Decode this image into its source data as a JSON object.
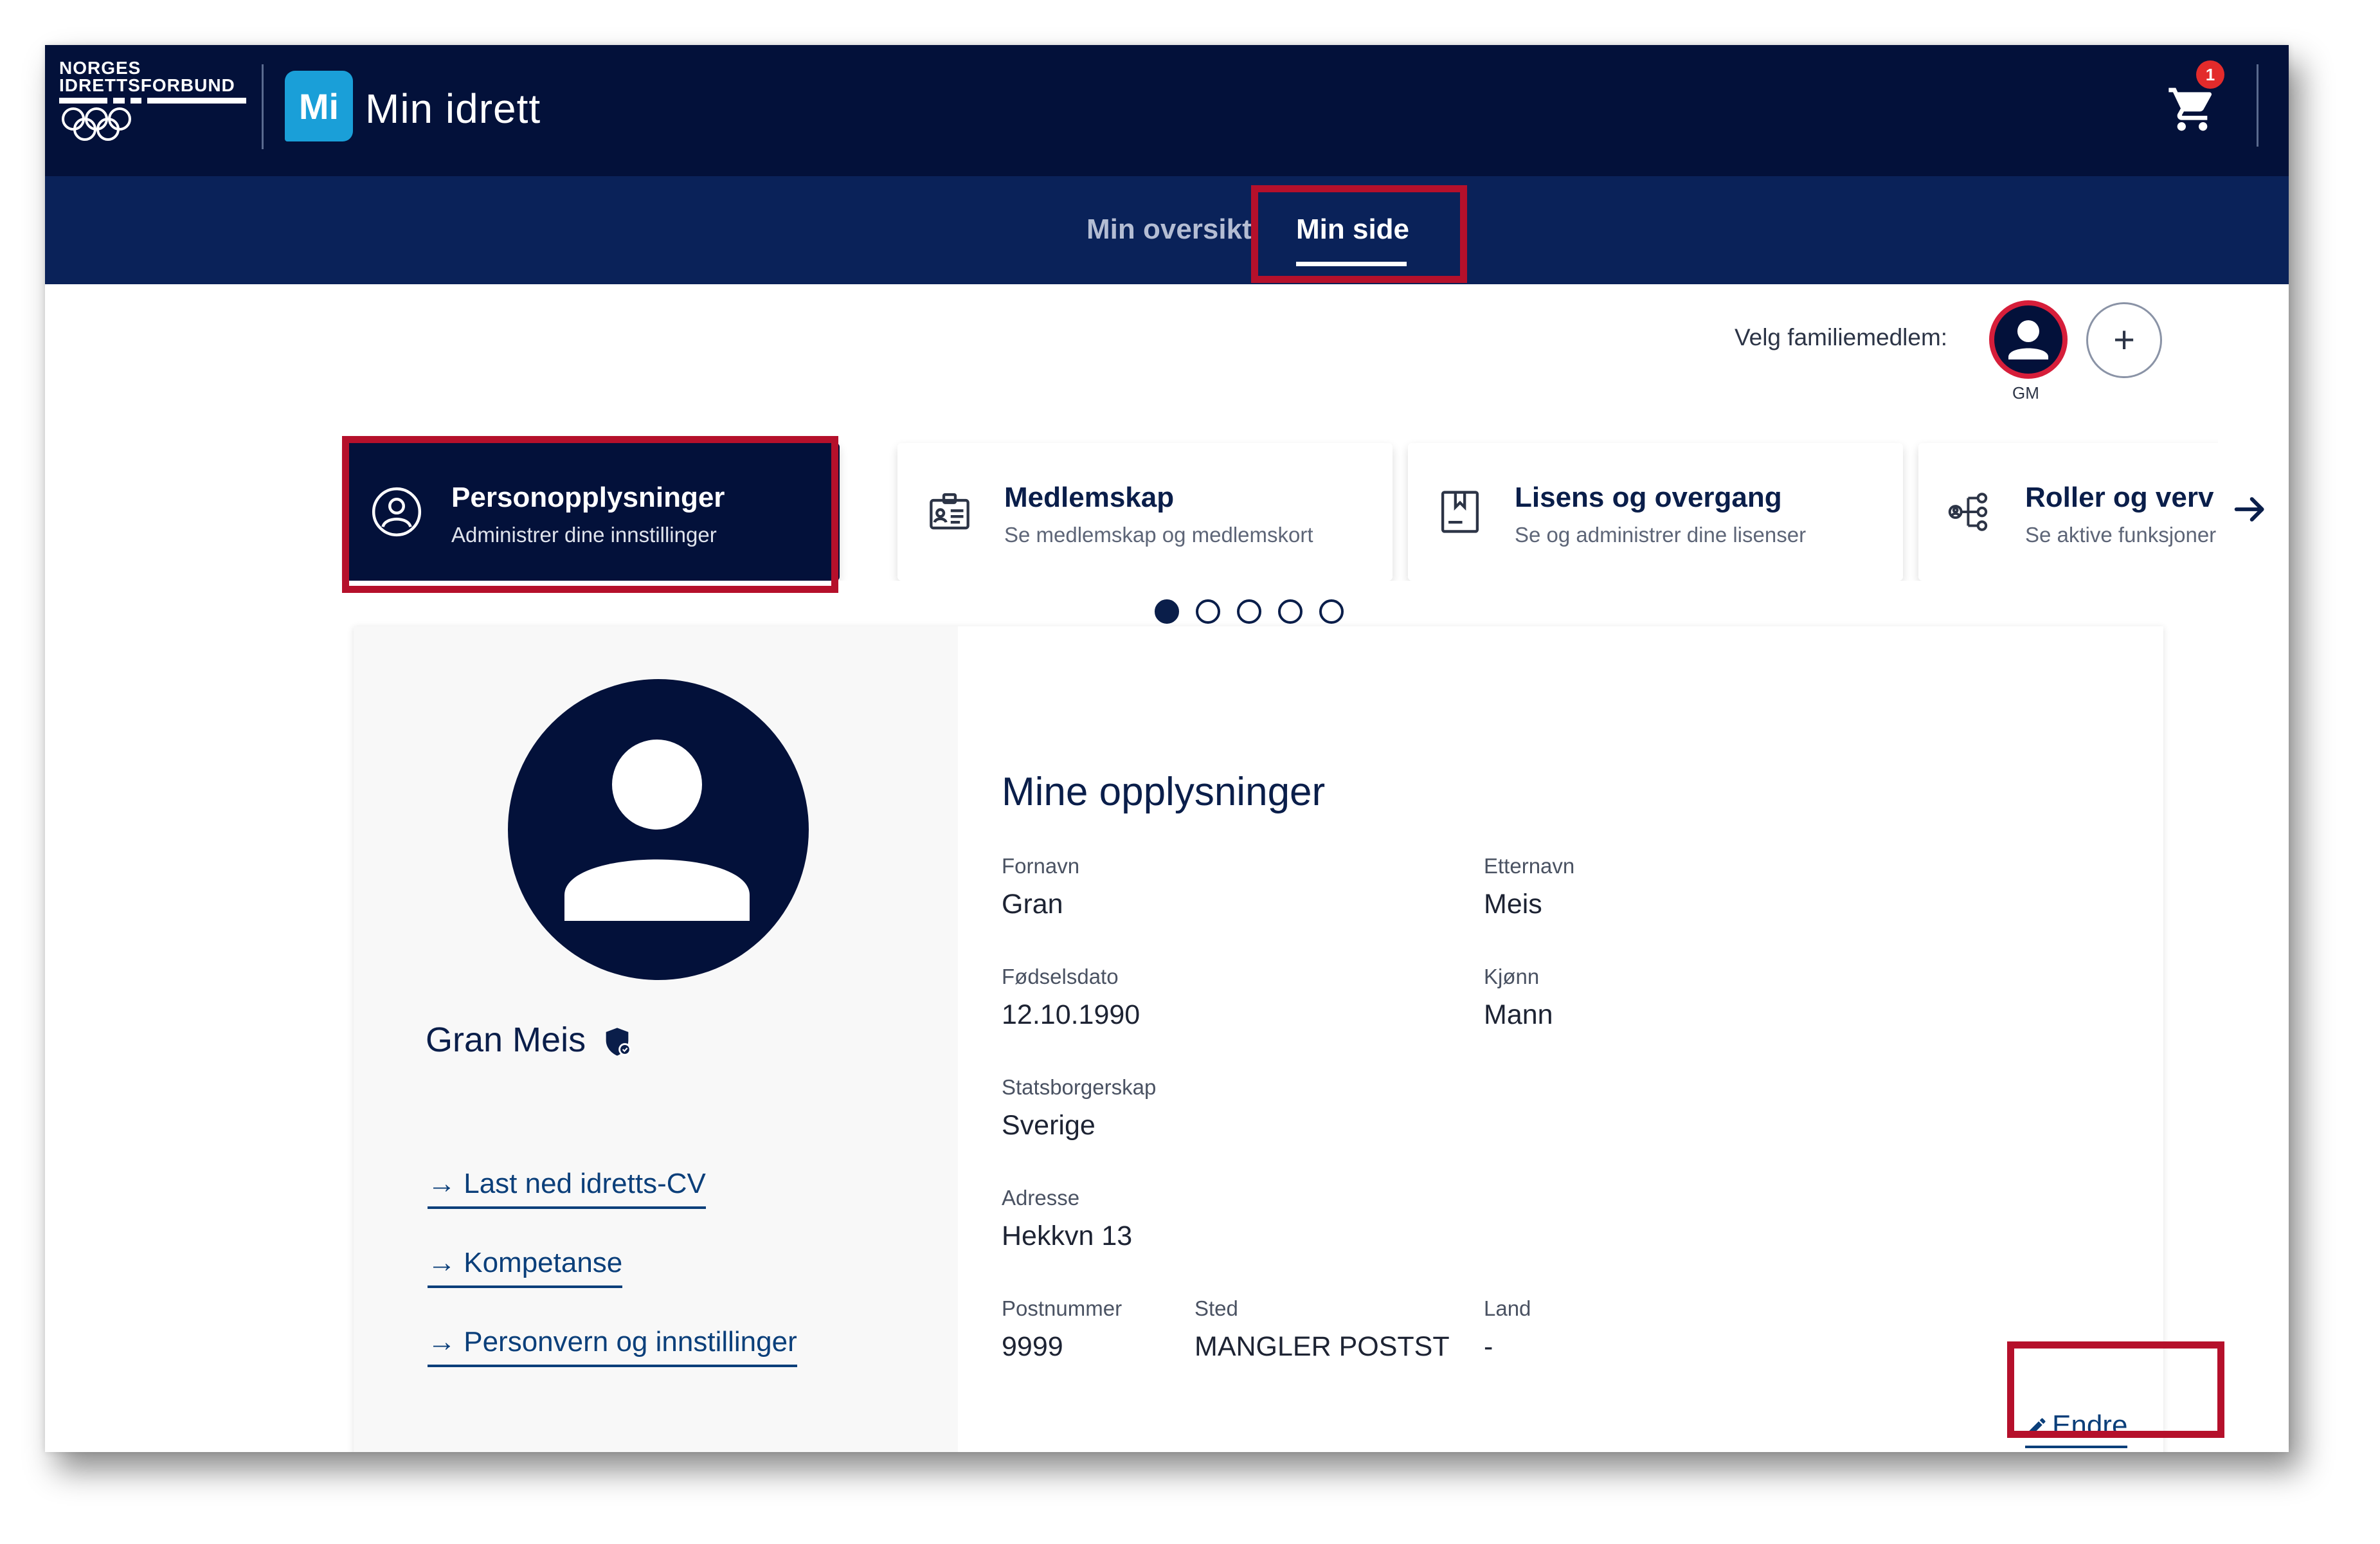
{
  "header": {
    "org_logo_lines": [
      "NORGES",
      "IDRETTSFORBUND"
    ],
    "app_badge": "Mi",
    "app_name": "Min idrett",
    "cart_count": "1"
  },
  "nav": {
    "tabs": [
      {
        "label": "Min oversikt",
        "active": false
      },
      {
        "label": "Min side",
        "active": true
      }
    ]
  },
  "family": {
    "label": "Velg familiemedlem:",
    "member_initials": "GM",
    "add_symbol": "+"
  },
  "cards": [
    {
      "title": "Personopplysninger",
      "subtitle": "Administrer dine innstillinger",
      "icon": "person-circle-icon",
      "active": true
    },
    {
      "title": "Medlemskap",
      "subtitle": "Se medlemskap og medlemskort",
      "icon": "membership-card-icon",
      "active": false
    },
    {
      "title": "Lisens og overgang",
      "subtitle": "Se og administrer dine lisenser",
      "icon": "license-book-icon",
      "active": false
    },
    {
      "title": "Roller og verv",
      "subtitle": "Se aktive funksjoner",
      "icon": "roles-tree-icon",
      "active": false
    }
  ],
  "carousel": {
    "page_count": 5,
    "current_page": 1
  },
  "profile": {
    "name": "Gran Meis",
    "links": [
      "→ Last ned idretts-CV",
      "→ Kompetanse",
      "→ Personvern og innstillinger"
    ]
  },
  "details": {
    "title": "Mine opplysninger",
    "fields": {
      "first_name": {
        "label": "Fornavn",
        "value": "Gran"
      },
      "last_name": {
        "label": "Etternavn",
        "value": "Meis"
      },
      "birth_date": {
        "label": "Fødselsdato",
        "value": "12.10.1990"
      },
      "gender": {
        "label": "Kjønn",
        "value": "Mann"
      },
      "citizenship": {
        "label": "Statsborgerskap",
        "value": "Sverige"
      },
      "address": {
        "label": "Adresse",
        "value": "Hekkvn 13"
      },
      "postal_code": {
        "label": "Postnummer",
        "value": "9999"
      },
      "city": {
        "label": "Sted",
        "value": "MANGLER POSTST"
      },
      "country": {
        "label": "Land",
        "value": "-"
      }
    },
    "edit_label": "Endre"
  },
  "colors": {
    "header_bg": "#03113a",
    "nav_bg": "#0a2259",
    "accent_blue": "#1a9fd8",
    "highlight_red": "#b5102b",
    "link_color": "#0b3f7a"
  }
}
